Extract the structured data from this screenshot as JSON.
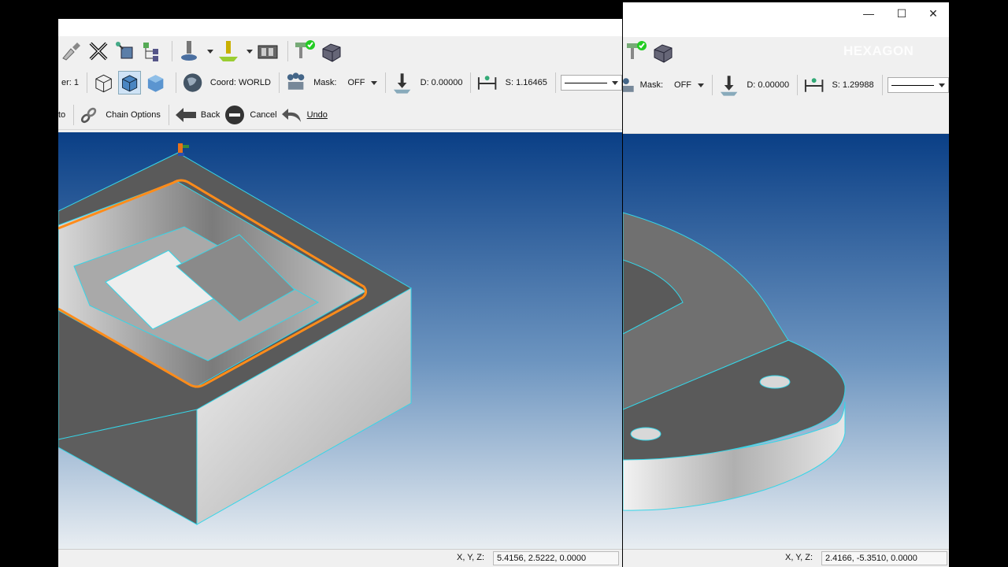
{
  "left": {
    "toolbar2": {
      "layer_text": "er: 1",
      "coord_text": "Coord: WORLD",
      "mask_label": "Mask:",
      "mask_value": "OFF",
      "depth_text": "D: 0.00000",
      "spacing_text": "S: 1.16465"
    },
    "toolbar3": {
      "auto_text": "to",
      "chain_options": "Chain Options",
      "back": "Back",
      "cancel": "Cancel",
      "undo": "Undo"
    },
    "status": {
      "label": "X, Y, Z:",
      "value": "5.4156, 2.5222, 0.0000"
    }
  },
  "right": {
    "watermark": "HEXAGON",
    "toolbar2": {
      "mask_label": "Mask:",
      "mask_value": "OFF",
      "depth_text": "D: 0.00000",
      "spacing_text": "S: 1.29988"
    },
    "status": {
      "label": "X, Y, Z:",
      "value": "2.4166, -5.3510, 0.0000"
    }
  },
  "colors": {
    "chain_highlight": "#ff8c1a",
    "edge_outline": "#35d6e8",
    "viewport_top": "#0a3f86",
    "viewport_bottom": "#e9eef2"
  },
  "icons": [
    "brush-icon",
    "delete-icon",
    "transform-icon",
    "tree-icon",
    "insert-point-icon",
    "wireframe-icon",
    "shaded-icon",
    "globe-icon",
    "mask-icon",
    "depth-icon",
    "spacing-icon",
    "chain-icon",
    "back-arrow-icon",
    "cancel-icon",
    "undo-icon",
    "minimize-icon",
    "maximize-icon",
    "close-icon",
    "axis-triad-icon"
  ]
}
